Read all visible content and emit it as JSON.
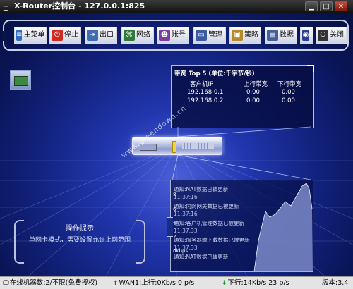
{
  "window": {
    "title": "X-Router控制台 - 127.0.0.1:825"
  },
  "toolbar": {
    "buttons": [
      {
        "label": "主菜单",
        "icon": "menu-icon",
        "color": "#2d6cc4"
      },
      {
        "label": "停止",
        "icon": "power-icon",
        "color": "#d02b20"
      },
      {
        "label": "出口",
        "icon": "exit-icon",
        "color": "#3f6db3"
      },
      {
        "label": "网络",
        "icon": "network-icon",
        "color": "#2f7a3a"
      },
      {
        "label": "账号",
        "icon": "users-icon",
        "color": "#7a3f9e"
      },
      {
        "label": "管理",
        "icon": "monitor-icon",
        "color": "#3b5aa0"
      },
      {
        "label": "策略",
        "icon": "box-icon",
        "color": "#b58a2a"
      },
      {
        "label": "数据",
        "icon": "data-icon",
        "color": "#44609a"
      },
      {
        "label": "",
        "icon": "globe-icon",
        "color": "#2a3f8f"
      },
      {
        "label": "关闭",
        "icon": "shutdown-icon",
        "color": "#333333"
      }
    ]
  },
  "bandwidth": {
    "title": "带宽 Top 5 (单位:千字节/秒)",
    "columns": [
      "客户机IP",
      "上行带宽",
      "下行带宽"
    ],
    "rows": [
      [
        "192.168.0.1",
        "0.00",
        "0.00"
      ],
      [
        "192.168.0.2",
        "0.00",
        "0.00"
      ]
    ]
  },
  "watermark": "www.greendown.cn",
  "log": {
    "items": [
      {
        "msg": "通知:NAT数据已被更新",
        "time": "11:37:16"
      },
      {
        "msg": "通知:内网网关数据已被更新",
        "time": "11:37:16"
      },
      {
        "msg": "通知:客户机管理数据已被更新",
        "time": "11:37:33"
      },
      {
        "msg": "通知:服务器端下载数据已被更新",
        "time": "11:37:33"
      },
      {
        "msg": "通知:NAT数据已被更新",
        "time": ""
      }
    ],
    "axis_labels": [
      "8",
      "6",
      "4",
      "2",
      "0kbps"
    ]
  },
  "hint": {
    "title": "操作提示",
    "text": "单网卡模式，需要设置允许上网范围"
  },
  "status": {
    "online": "在线机器数:2/不限(免费授权)",
    "wan": "WAN1:上行:0Kb/s 0 p/s",
    "down": "下行:14Kb/s 23 p/s",
    "version": "版本:3.4"
  }
}
